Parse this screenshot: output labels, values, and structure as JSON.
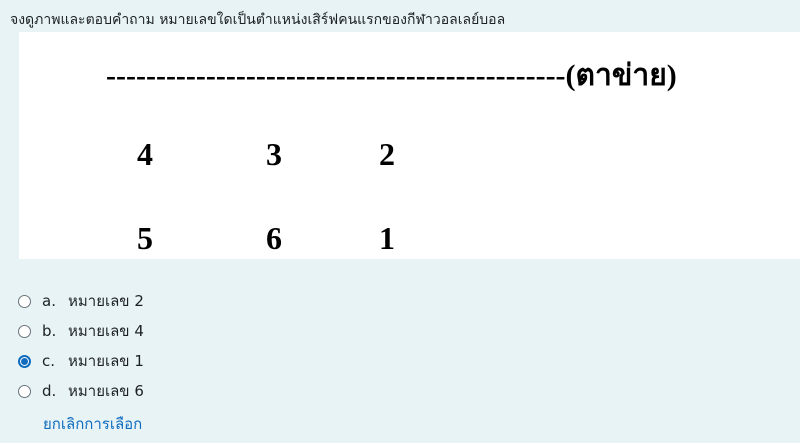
{
  "question": {
    "text": "จงดูภาพและตอบคำถาม หมายเลขใดเป็นตำแหน่งเสิร์ฟคนแรกของกีฬาวอลเลย์บอล"
  },
  "figure": {
    "net_label": "----------------------------------------------(ตาข่าย)",
    "front_row": [
      "4",
      "3",
      "2"
    ],
    "back_row": [
      "5",
      "6",
      "1"
    ]
  },
  "answers": [
    {
      "letter": "a.",
      "label": "หมายเลข 2",
      "checked": false
    },
    {
      "letter": "b.",
      "label": "หมายเลข 4",
      "checked": false
    },
    {
      "letter": "c.",
      "label": "หมายเลข 1",
      "checked": true
    },
    {
      "letter": "d.",
      "label": "หมายเลข 6",
      "checked": false
    }
  ],
  "clear_choice": "ยกเลิกการเลือก",
  "colors": {
    "background": "#e7f3f5",
    "accent": "#0f6cbf"
  }
}
